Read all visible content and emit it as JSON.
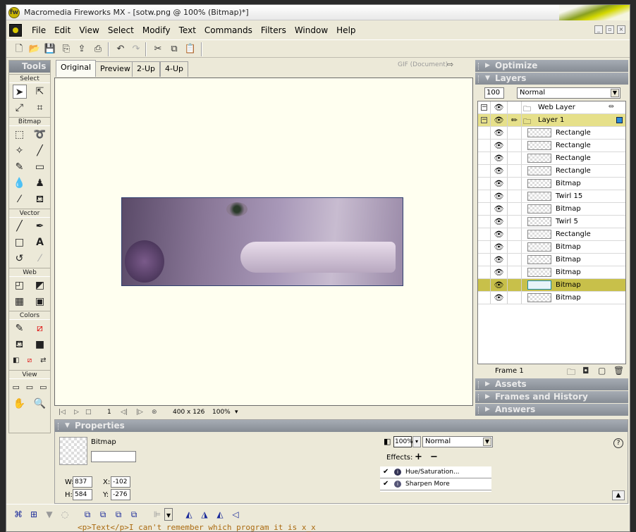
{
  "window": {
    "title": "Macromedia Fireworks MX - [sotw.png @  100% (Bitmap)*]"
  },
  "menu": [
    "File",
    "Edit",
    "View",
    "Select",
    "Modify",
    "Text",
    "Commands",
    "Filters",
    "Window",
    "Help"
  ],
  "tools": {
    "title": "Tools",
    "sections": {
      "select": "Select",
      "bitmap": "Bitmap",
      "vector": "Vector",
      "web": "Web",
      "colors": "Colors",
      "view": "View"
    }
  },
  "doc_tabs": [
    {
      "label": "Original",
      "active": true
    },
    {
      "label": "Preview",
      "active": false
    },
    {
      "label": "2-Up",
      "active": false
    },
    {
      "label": "4-Up",
      "active": false
    }
  ],
  "export_format": "GIF (Document)",
  "status": {
    "frame": "1",
    "image_size": "400 x 126",
    "zoom": "100%"
  },
  "panels": {
    "optimize": "Optimize",
    "layers": "Layers",
    "assets": "Assets",
    "frames_history": "Frames and History",
    "answers": "Answers"
  },
  "layers_panel": {
    "opacity": "100",
    "blend_mode": "Normal",
    "web_layer": "Web Layer",
    "layer1": "Layer 1",
    "objects": [
      {
        "name": "Rectangle",
        "selected": false
      },
      {
        "name": "Rectangle",
        "selected": false
      },
      {
        "name": "Rectangle",
        "selected": false
      },
      {
        "name": "Rectangle",
        "selected": false
      },
      {
        "name": "Bitmap",
        "selected": false
      },
      {
        "name": "Twirl 15",
        "selected": false
      },
      {
        "name": "Bitmap",
        "selected": false
      },
      {
        "name": "Twirl 5",
        "selected": false
      },
      {
        "name": "Rectangle",
        "selected": false
      },
      {
        "name": "Bitmap",
        "selected": false
      },
      {
        "name": "Bitmap",
        "selected": false
      },
      {
        "name": "Bitmap",
        "selected": false
      },
      {
        "name": "Bitmap",
        "selected": true
      },
      {
        "name": "Bitmap",
        "selected": false
      }
    ],
    "frame_label": "Frame 1"
  },
  "properties": {
    "title": "Properties",
    "object_type": "Bitmap",
    "object_name": "",
    "w_label": "W:",
    "w": "837",
    "h_label": "H:",
    "h": "584",
    "x_label": "X:",
    "x": "-102",
    "y_label": "Y:",
    "y": "-276",
    "opacity": "100%",
    "blend_mode": "Normal",
    "effects_label": "Effects:",
    "effects": [
      {
        "name": "Hue/Saturation...",
        "enabled": true
      },
      {
        "name": "Sharpen More",
        "enabled": true
      }
    ]
  },
  "background_text": "<p>Text</p>I can't remember which program it is x_x",
  "colors": {
    "accent_selected": "#c8c04a",
    "layer_row": "#e6e08a",
    "canvas_bg": "#fffff0",
    "panel_header": "#868c94"
  }
}
